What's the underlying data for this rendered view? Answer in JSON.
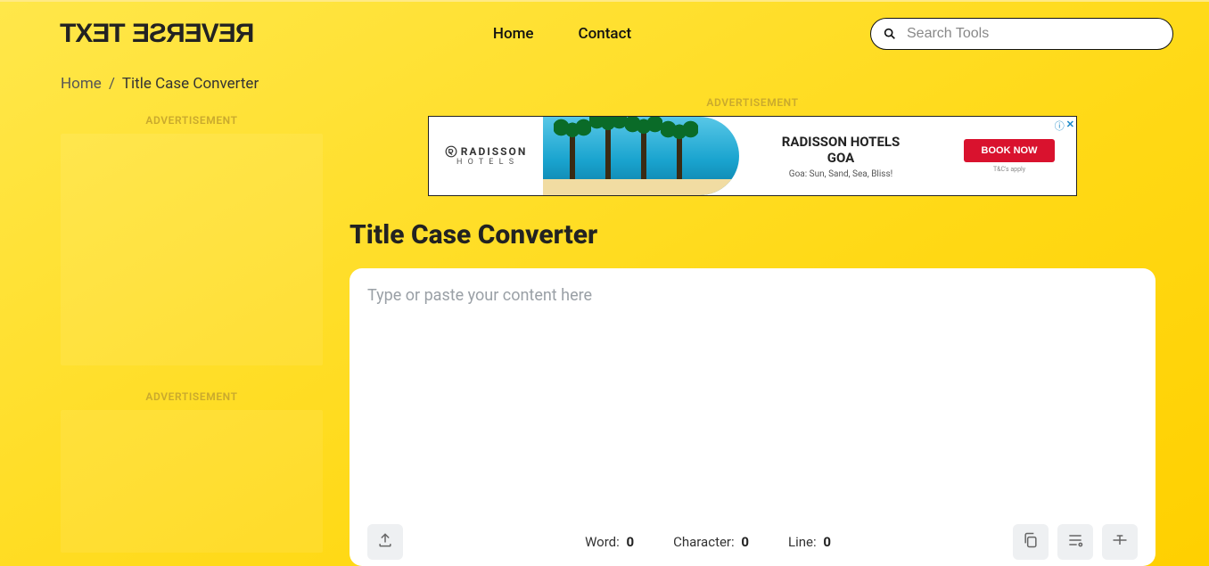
{
  "logo": {
    "part1": "TEXT",
    "part2": "REVERSE"
  },
  "nav": {
    "home": "Home",
    "contact": "Contact"
  },
  "search": {
    "placeholder": "Search Tools",
    "value": ""
  },
  "breadcrumb": {
    "home": "Home",
    "sep": "/",
    "current": "Title Case Converter"
  },
  "ads": {
    "label": "ADVERTISEMENT",
    "leaderboard": {
      "brand_top": "RADISSON",
      "brand_bottom": "H O T E L S",
      "title_line1": "RADISSON HOTELS",
      "title_line2": "GOA",
      "tagline": "Goa: Sun, Sand, Sea, Bliss!",
      "cta": "BOOK NOW",
      "tnc": "T&C's apply"
    }
  },
  "page": {
    "title": "Title Case Converter"
  },
  "tool": {
    "placeholder": "Type or paste your content here",
    "value": "",
    "stats": {
      "word_label": "Word:",
      "word_value": "0",
      "char_label": "Character:",
      "char_value": "0",
      "line_label": "Line:",
      "line_value": "0"
    }
  }
}
